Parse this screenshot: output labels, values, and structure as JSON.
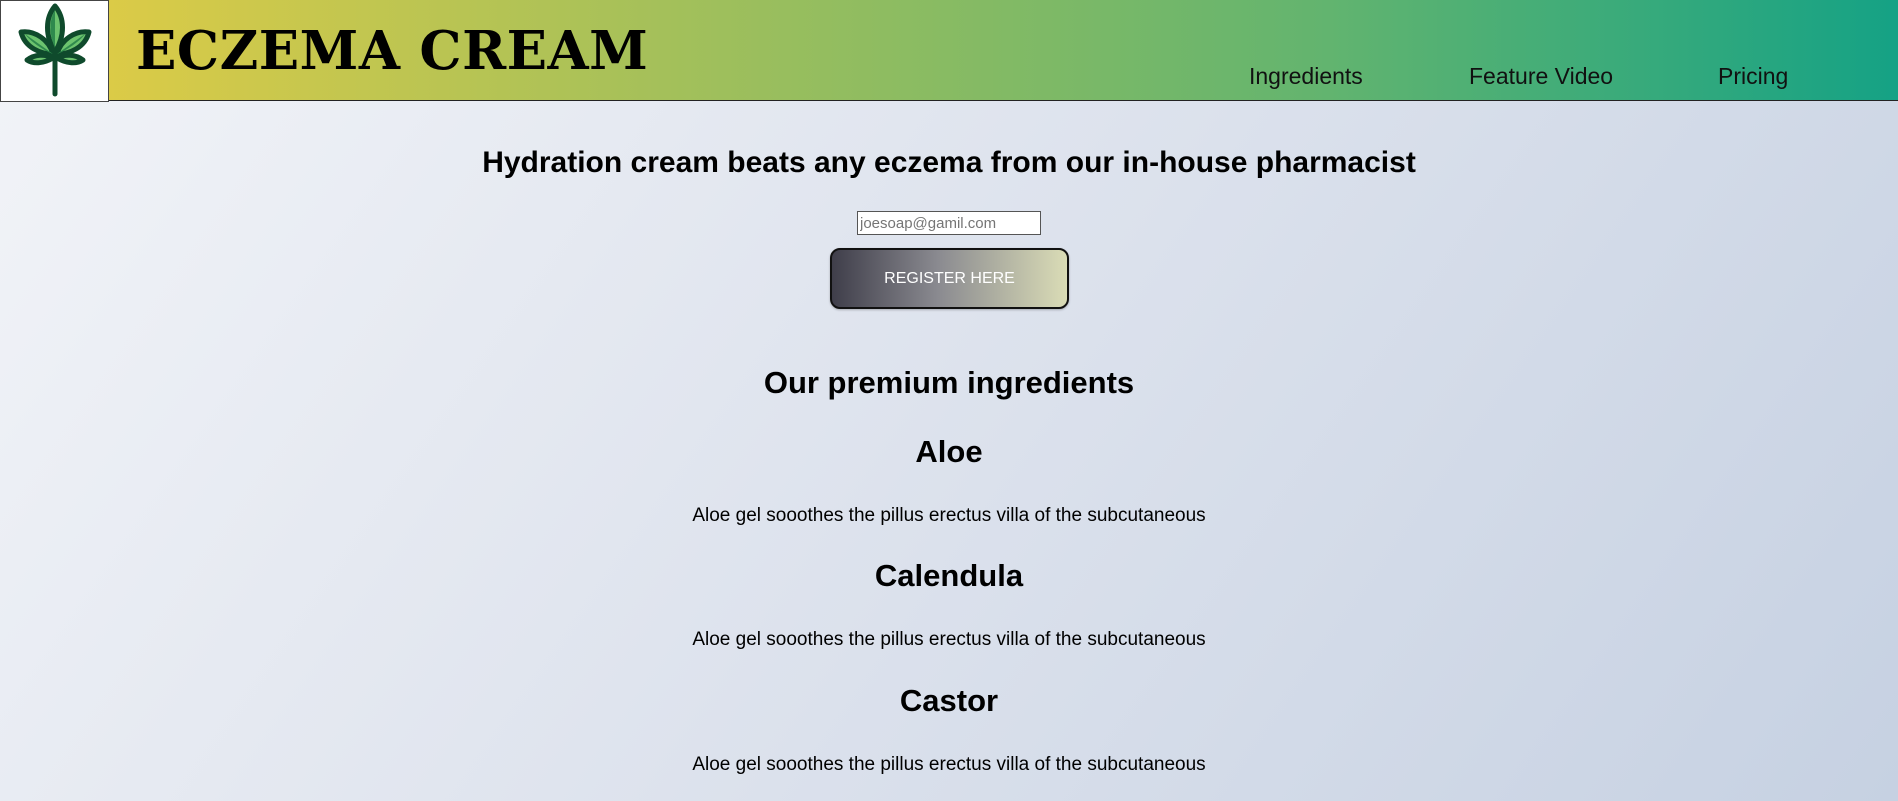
{
  "header": {
    "brand": "ECZEMA CREAM",
    "logo_icon": "cannabis-leaf-icon",
    "nav": [
      {
        "label": "Ingredients"
      },
      {
        "label": "Feature Video"
      },
      {
        "label": "Pricing"
      }
    ],
    "gradient_colors": [
      "#e6cd43",
      "#15a285"
    ]
  },
  "hero": {
    "title": "Hydration cream beats any eczema from our in-house pharmacist",
    "email_placeholder": "joesoap@gamil.com",
    "register_label": "REGISTER HERE"
  },
  "ingredients": {
    "title": "Our premium ingredients",
    "items": [
      {
        "name": "Aloe",
        "description": "Aloe gel sooothes the pillus erectus villa of the subcutaneous"
      },
      {
        "name": "Calendula",
        "description": "Aloe gel sooothes the pillus erectus villa of the subcutaneous"
      },
      {
        "name": "Castor",
        "description": "Aloe gel sooothes the pillus erectus villa of the subcutaneous"
      }
    ]
  }
}
